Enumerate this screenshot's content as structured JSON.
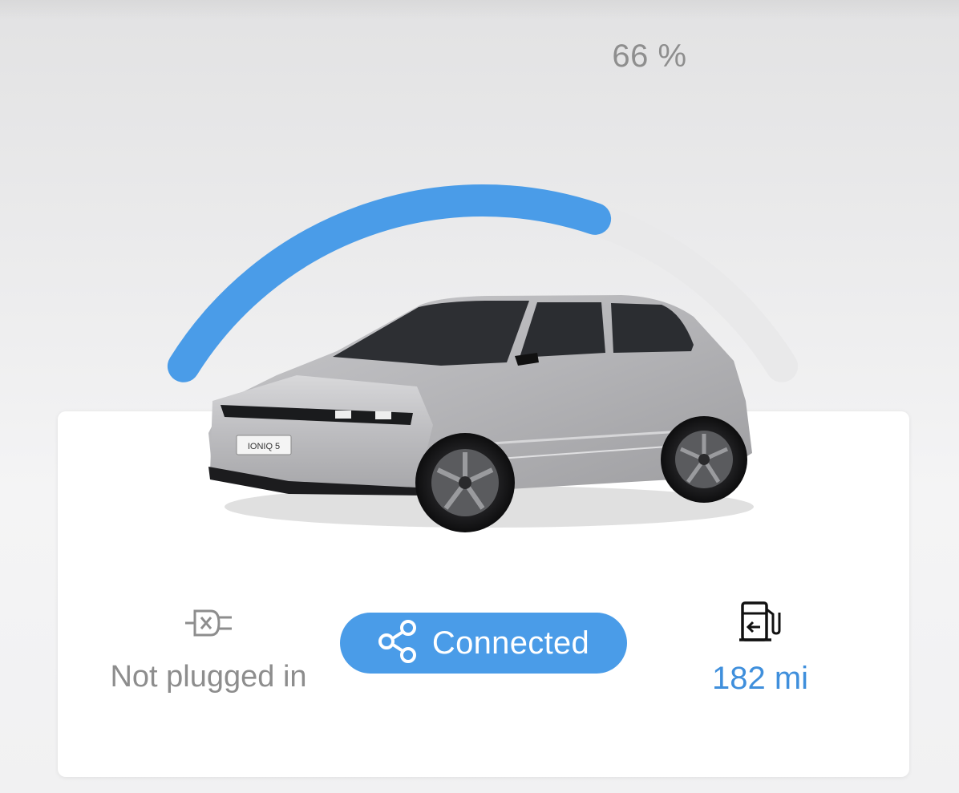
{
  "battery": {
    "percent_label": "66 %",
    "charge_fraction": 0.66,
    "accent_color": "#4a9ce8",
    "track_color": "#e9e9ea"
  },
  "vehicle": {
    "badge_text": "IONIQ 5",
    "image_icon": "car-illustration"
  },
  "plug": {
    "icon": "plug-disconnected-icon",
    "status_text": "Not plugged in"
  },
  "connection": {
    "icon": "share-icon",
    "label": "Connected",
    "color": "#4a9ce8"
  },
  "range": {
    "icon": "fuel-pump-icon",
    "value": "182 mi",
    "color": "#3f8fdc"
  }
}
